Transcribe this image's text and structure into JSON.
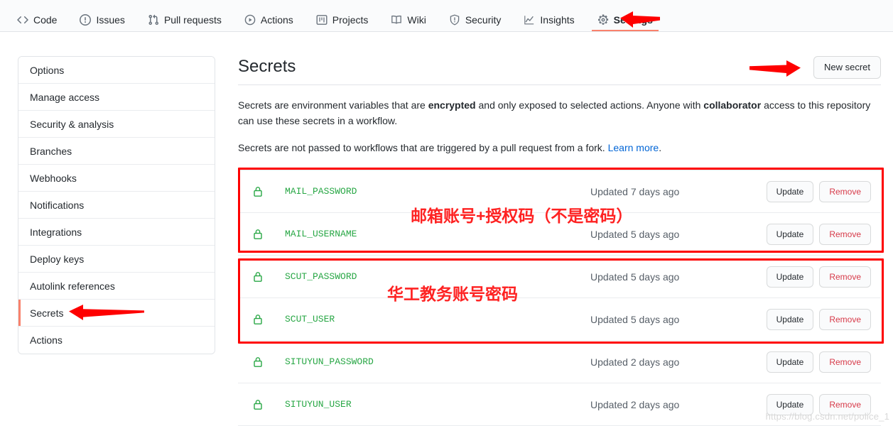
{
  "repo_nav": {
    "items": [
      {
        "label": "Code",
        "icon": "code-icon",
        "active": false
      },
      {
        "label": "Issues",
        "icon": "issue-opened-icon",
        "active": false
      },
      {
        "label": "Pull requests",
        "icon": "git-pull-request-icon",
        "active": false
      },
      {
        "label": "Actions",
        "icon": "play-icon",
        "active": false
      },
      {
        "label": "Projects",
        "icon": "project-icon",
        "active": false
      },
      {
        "label": "Wiki",
        "icon": "book-icon",
        "active": false
      },
      {
        "label": "Security",
        "icon": "shield-icon",
        "active": false
      },
      {
        "label": "Insights",
        "icon": "graph-icon",
        "active": false
      },
      {
        "label": "Settings",
        "icon": "gear-icon",
        "active": true
      }
    ]
  },
  "sidebar": {
    "items": [
      {
        "label": "Options",
        "active": false
      },
      {
        "label": "Manage access",
        "active": false
      },
      {
        "label": "Security & analysis",
        "active": false
      },
      {
        "label": "Branches",
        "active": false
      },
      {
        "label": "Webhooks",
        "active": false
      },
      {
        "label": "Notifications",
        "active": false
      },
      {
        "label": "Integrations",
        "active": false
      },
      {
        "label": "Deploy keys",
        "active": false
      },
      {
        "label": "Autolink references",
        "active": false
      },
      {
        "label": "Secrets",
        "active": true
      },
      {
        "label": "Actions",
        "active": false
      }
    ]
  },
  "main": {
    "title": "Secrets",
    "new_secret_label": "New secret",
    "description_1_part1": "Secrets are environment variables that are ",
    "description_1_bold1": "encrypted",
    "description_1_part2": " and only exposed to selected actions. Anyone with ",
    "description_1_bold2": "collaborator",
    "description_1_part3": " access to this repository can use these secrets in a workflow.",
    "description_2_text": "Secrets are not passed to workflows that are triggered by a pull request from a fork. ",
    "description_2_link": "Learn more",
    "description_2_end": "."
  },
  "secrets": {
    "update_label": "Update",
    "remove_label": "Remove",
    "lock_icon": "lock-icon",
    "rows": [
      {
        "name": "MAIL_PASSWORD",
        "updated": "Updated 7 days ago"
      },
      {
        "name": "MAIL_USERNAME",
        "updated": "Updated 5 days ago"
      },
      {
        "name": "SCUT_PASSWORD",
        "updated": "Updated 5 days ago"
      },
      {
        "name": "SCUT_USER",
        "updated": "Updated 5 days ago"
      },
      {
        "name": "SITUYUN_PASSWORD",
        "updated": "Updated 2 days ago"
      },
      {
        "name": "SITUYUN_USER",
        "updated": "Updated 2 days ago"
      }
    ]
  },
  "annotations": {
    "color": "#fe0000",
    "note_mail": "邮箱账号+授权码（不是密码）",
    "note_scut": "华工教务账号密码",
    "arrow_settings": "arrow-left-icon",
    "arrow_new_secret": "arrow-right-icon",
    "arrow_sidebar_secrets": "arrow-left-icon"
  },
  "watermark": {
    "text": "https://blog.csdn.net/police_1"
  }
}
